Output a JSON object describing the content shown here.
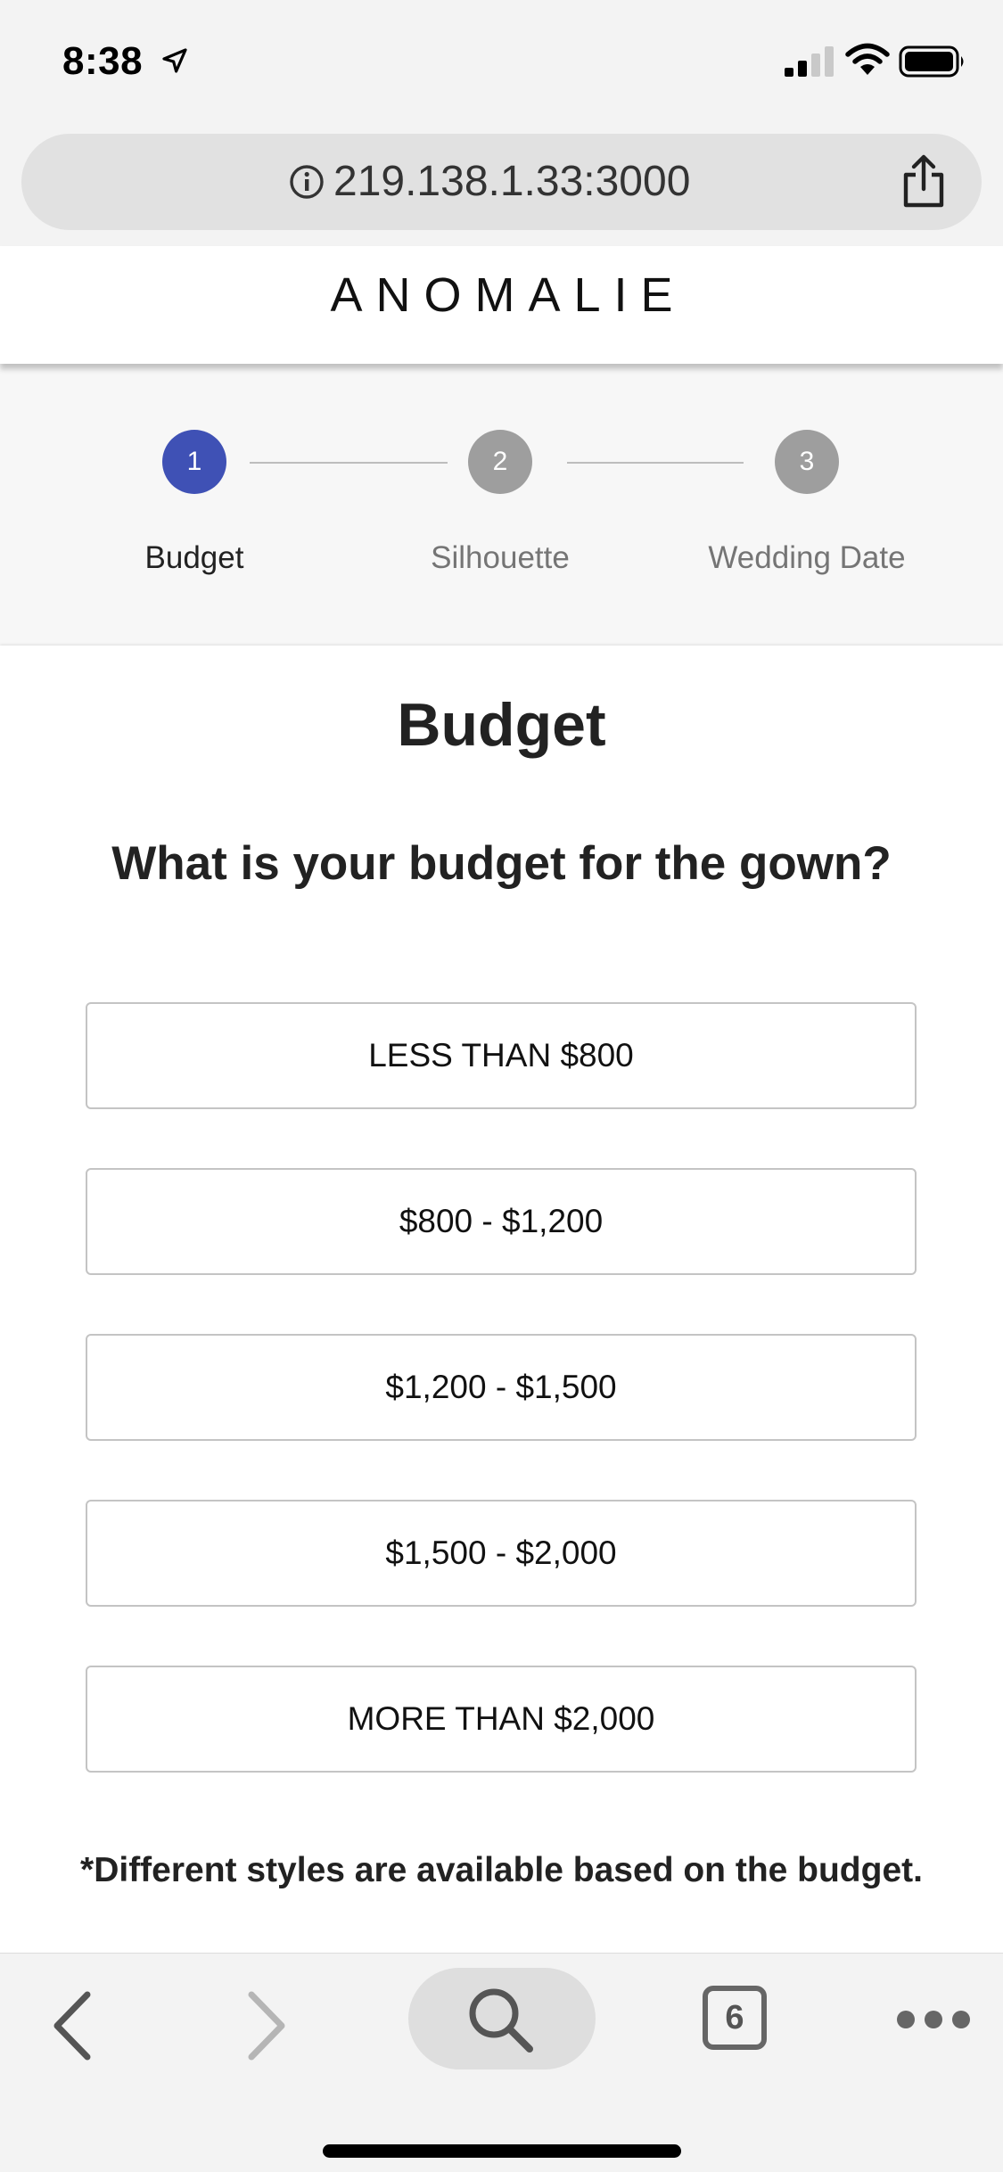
{
  "status_bar": {
    "time": "8:38",
    "icons": [
      "location-arrow-icon",
      "cellular-signal-icon",
      "wifi-icon",
      "battery-icon"
    ]
  },
  "browser": {
    "url": "219.138.1.33:3000",
    "icons": [
      "info-icon",
      "share-icon"
    ]
  },
  "site": {
    "brand": "ANOMALIE"
  },
  "stepper": {
    "steps": [
      {
        "number": "1",
        "label": "Budget",
        "active": true
      },
      {
        "number": "2",
        "label": "Silhouette",
        "active": false
      },
      {
        "number": "3",
        "label": "Wedding Date",
        "active": false
      }
    ]
  },
  "main": {
    "title": "Budget",
    "question": "What is your budget for the gown?",
    "options": [
      "LESS THAN $800",
      "$800 - $1,200",
      "$1,200 - $1,500",
      "$1,500 - $2,000",
      "MORE THAN $2,000"
    ],
    "footnote": "*Different styles are available based on the budget."
  },
  "toolbar": {
    "tab_count": "6",
    "icons": [
      "back-icon",
      "forward-icon",
      "search-icon",
      "tabs-icon",
      "more-icon"
    ]
  },
  "colors": {
    "accent": "#3f51b5",
    "inactive_step": "#9e9e9e",
    "text": "#222222",
    "border": "#c4c4c4"
  }
}
